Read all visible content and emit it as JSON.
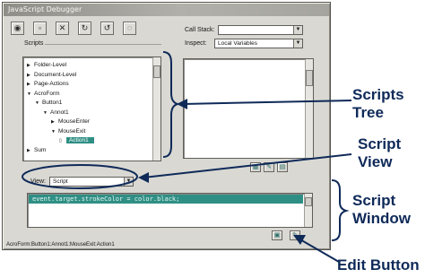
{
  "window": {
    "title": "JavaScript Debugger"
  },
  "toolbar": {
    "buttons": [
      {
        "name": "go-button",
        "icon": "go-icon",
        "glyph": "◉"
      },
      {
        "name": "step-over-button",
        "icon": "step-over-icon",
        "glyph": "▫"
      },
      {
        "name": "clear-button",
        "icon": "close-icon",
        "glyph": "✕"
      },
      {
        "name": "step-into-button",
        "icon": "step-into-icon",
        "glyph": "↻"
      },
      {
        "name": "step-out-button",
        "icon": "step-out-icon",
        "glyph": "↺"
      },
      {
        "name": "breakpoint-button",
        "icon": "breakpoint-icon",
        "glyph": "◌"
      }
    ]
  },
  "callstack": {
    "label": "Call Stack:",
    "value": ""
  },
  "scripts": {
    "label": "Scripts",
    "tree": [
      {
        "label": "Folder-Level",
        "level": 0,
        "expanded": false,
        "selected": false
      },
      {
        "label": "Document-Level",
        "level": 0,
        "expanded": false,
        "selected": false
      },
      {
        "label": "Page-Actions",
        "level": 0,
        "expanded": false,
        "selected": false
      },
      {
        "label": "AcroForm",
        "level": 0,
        "expanded": true,
        "selected": false
      },
      {
        "label": "Button1",
        "level": 1,
        "expanded": true,
        "selected": false
      },
      {
        "label": "Annot1",
        "level": 2,
        "expanded": true,
        "selected": false
      },
      {
        "label": "MouseEnter",
        "level": 3,
        "expanded": false,
        "selected": false
      },
      {
        "label": "MouseExit",
        "level": 3,
        "expanded": true,
        "selected": false
      },
      {
        "label": "Action1",
        "level": 4,
        "expanded": false,
        "selected": true
      },
      {
        "label": "Sum",
        "level": 0,
        "expanded": false,
        "selected": false
      }
    ]
  },
  "inspect": {
    "label": "Inspect:",
    "value": "Local Variables"
  },
  "view": {
    "label": "View:",
    "value": "Script"
  },
  "script_window": {
    "code": "event.target.strokeColor = color.black;"
  },
  "status": {
    "path": "AcroForm:Button1:Annot1:MouseExit:Action1"
  },
  "callouts": {
    "scripts_tree": [
      "Scripts",
      "Tree"
    ],
    "script_view": [
      "Script",
      "View"
    ],
    "script_window": [
      "Script",
      "Window"
    ],
    "edit_button": "Edit Button"
  },
  "colors": {
    "selection": "#2f8f85",
    "callout_text": "#0f2a59",
    "window_face": "#d9d8d2"
  }
}
